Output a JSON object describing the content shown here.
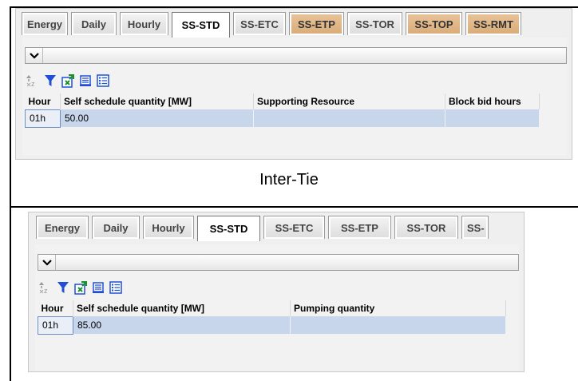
{
  "caption": "Inter-Tie",
  "panels": [
    {
      "tabs": [
        {
          "label": "Energy",
          "state": "normal"
        },
        {
          "label": "Daily",
          "state": "normal"
        },
        {
          "label": "Hourly",
          "state": "normal"
        },
        {
          "label": "SS-STD",
          "state": "active"
        },
        {
          "label": "SS-ETC",
          "state": "normal"
        },
        {
          "label": "SS-ETP",
          "state": "highlight"
        },
        {
          "label": "SS-TOR",
          "state": "normal"
        },
        {
          "label": "SS-TOP",
          "state": "highlight"
        },
        {
          "label": "SS-RMT",
          "state": "highlight"
        }
      ],
      "columns": [
        "Hour",
        "Self schedule quantity [MW]",
        "Supporting Resource",
        "Block bid hours"
      ],
      "rows": [
        [
          "01h",
          "50.00",
          "",
          ""
        ]
      ]
    },
    {
      "tabs": [
        {
          "label": "Energy",
          "state": "normal"
        },
        {
          "label": "Daily",
          "state": "normal"
        },
        {
          "label": "Hourly",
          "state": "normal"
        },
        {
          "label": "SS-STD",
          "state": "active"
        },
        {
          "label": "SS-ETC",
          "state": "normal"
        },
        {
          "label": "SS-ETP",
          "state": "normal"
        },
        {
          "label": "SS-TOR",
          "state": "normal"
        },
        {
          "label": "SS-",
          "state": "normal"
        }
      ],
      "columns": [
        "Hour",
        "Self schedule quantity [MW]",
        "Pumping quantity"
      ],
      "rows": [
        [
          "01h",
          "85.00",
          ""
        ]
      ]
    }
  ],
  "toolbar": {
    "icons": [
      "sort-icon",
      "filter-icon",
      "export-excel-icon",
      "print-icon",
      "column-chooser-icon"
    ]
  },
  "colors": {
    "highlight_tab": "#d9ab78",
    "selected_row": "#c8d6ec",
    "filter_blue": "#1f4fd6"
  }
}
